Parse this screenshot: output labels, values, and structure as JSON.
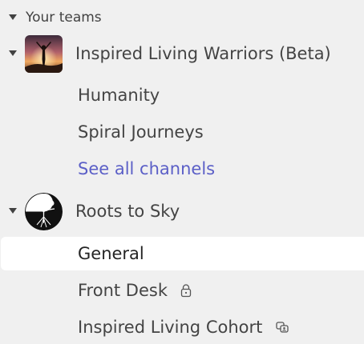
{
  "section": {
    "label": "Your teams"
  },
  "teams": [
    {
      "name": "Inspired Living Warriors (Beta)",
      "avatar_icon": "person-sunrise-avatar",
      "channels": [
        {
          "label": "Humanity"
        },
        {
          "label": "Spiral Journeys"
        }
      ],
      "see_all_label": "See all channels"
    },
    {
      "name": "Roots to Sky",
      "avatar_icon": "tree-yin-yang-avatar",
      "channels": [
        {
          "label": "General",
          "selected": true
        },
        {
          "label": "Front Desk",
          "icon": "lock-icon"
        },
        {
          "label": "Inspired Living Cohort",
          "icon": "shared-channel-icon"
        }
      ]
    }
  ],
  "colors": {
    "background": "#f0f0f0",
    "selected_background": "#ffffff",
    "link": "#5b5fc7",
    "text": "#424242"
  }
}
